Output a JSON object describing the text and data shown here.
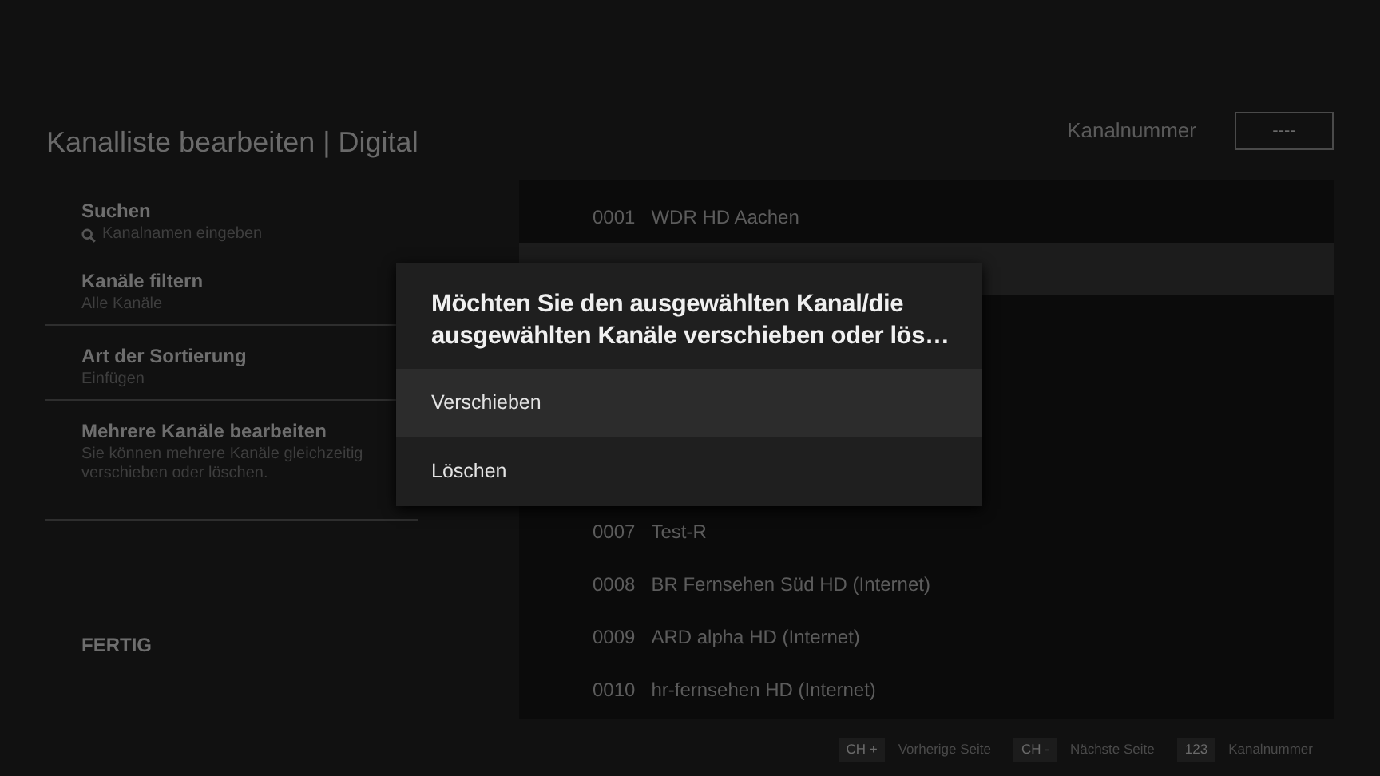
{
  "header": {
    "title": "Kanalliste bearbeiten | Digital",
    "channel_number_label": "Kanalnummer",
    "channel_number_value": "----"
  },
  "menu": [
    {
      "title": "Suchen",
      "subtitle": "Kanalnamen eingeben",
      "kind": "search"
    },
    {
      "title": "Kanäle filtern",
      "subtitle": "Alle Kanäle",
      "kind": "plain"
    },
    {
      "title": "Art der Sortierung",
      "subtitle": "Einfügen",
      "kind": "plain"
    },
    {
      "title": "Mehrere Kanäle bearbeiten",
      "subtitle": "Sie können mehrere Kanäle gleichzeitig verschieben oder löschen.",
      "kind": "plain"
    }
  ],
  "done_button": "FERTIG",
  "channels_top": [
    {
      "number": "0001",
      "name": "WDR HD Aachen",
      "selected": false
    }
  ],
  "channels_bottom": [
    {
      "number": "0007",
      "name": "Test-R",
      "selected": false
    },
    {
      "number": "0008",
      "name": "BR Fernsehen Süd HD (Internet)",
      "selected": false
    },
    {
      "number": "0009",
      "name": "ARD alpha HD (Internet)",
      "selected": false
    },
    {
      "number": "0010",
      "name": "hr-fernsehen HD (Internet)",
      "selected": false
    }
  ],
  "dialog": {
    "title": "Möchten Sie den ausgewählten Kanal/die ausgewählten Kanäle verschieben oder lös…",
    "options": [
      {
        "label": "Verschieben",
        "selected": true
      },
      {
        "label": "Löschen",
        "selected": false
      }
    ]
  },
  "footer": [
    {
      "key": "CH +",
      "label": "Vorherige Seite"
    },
    {
      "key": "CH -",
      "label": "Nächste Seite"
    },
    {
      "key": "123",
      "label": "Kanalnummer"
    }
  ]
}
